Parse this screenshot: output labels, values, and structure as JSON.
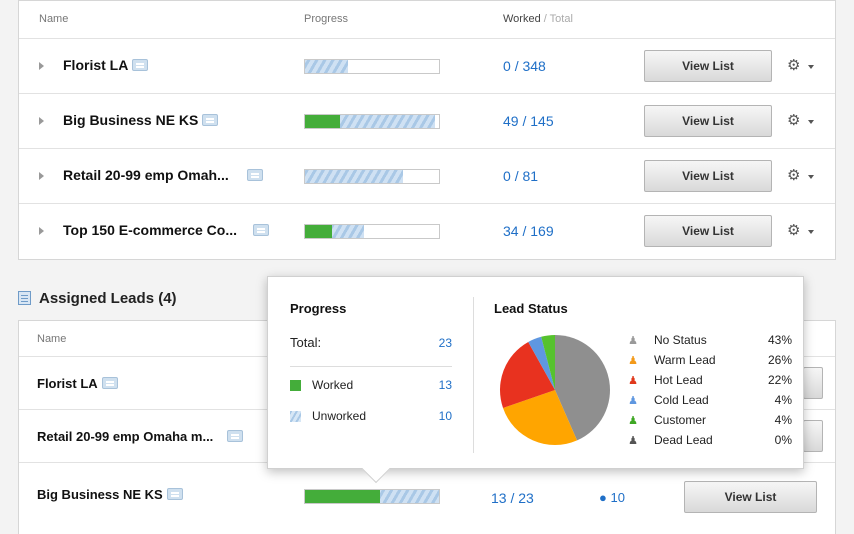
{
  "lists_table": {
    "headers": {
      "name": "Name",
      "progress": "Progress",
      "worked": "Worked",
      "total": "/ Total"
    },
    "rows": [
      {
        "name": "Florist LA",
        "worked": "0",
        "total": "/ 348",
        "progress_worked": 0,
        "progress_unworked": 0.32,
        "button": "View List"
      },
      {
        "name": "Big Business NE KS",
        "worked": "49",
        "total": "/ 145",
        "progress_worked": 0.26,
        "progress_unworked": 0.97,
        "button": "View List"
      },
      {
        "name": "Retail 20-99 emp Omah...",
        "worked": "0",
        "total": "/ 81",
        "progress_worked": 0,
        "progress_unworked": 0.73,
        "button": "View List"
      },
      {
        "name": "Top 150 E-commerce Co...",
        "worked": "34",
        "total": "/ 169",
        "progress_worked": 0.2,
        "progress_unworked": 0.44,
        "button": "View List"
      }
    ]
  },
  "assigned": {
    "title": "Assigned Leads (4)",
    "headers": {
      "name": "Name"
    },
    "rows": [
      {
        "name": "Florist LA"
      },
      {
        "name": "Retail 20-99 emp Omaha m..."
      },
      {
        "name": "Big Business NE KS",
        "worked": "13",
        "total": "/ 23",
        "unworked_count": "10",
        "progress_worked": 0.56,
        "progress_unworked": 1.0,
        "button": "View List"
      }
    ]
  },
  "popover": {
    "progress_title": "Progress",
    "total_label": "Total:",
    "total_value": "23",
    "worked_label": "Worked",
    "worked_value": "13",
    "unworked_label": "Unworked",
    "unworked_value": "10",
    "status_title": "Lead Status",
    "statuses": [
      {
        "label": "No Status",
        "pct": "43%",
        "value": 43,
        "color": "#8f8f8f",
        "icon_color": "#9a9a9a"
      },
      {
        "label": "Warm Lead",
        "pct": "26%",
        "value": 26,
        "color": "#ffa500",
        "icon_color": "#f39a1a"
      },
      {
        "label": "Hot Lead",
        "pct": "22%",
        "value": 22,
        "color": "#e8321f",
        "icon_color": "#e0391c"
      },
      {
        "label": "Cold Lead",
        "pct": "4%",
        "value": 4,
        "color": "#5f97e0",
        "icon_color": "#5f97e0"
      },
      {
        "label": "Customer",
        "pct": "4%",
        "value": 4,
        "color": "#56c22e",
        "icon_color": "#3ea724"
      },
      {
        "label": "Dead Lead",
        "pct": "0%",
        "value": 0,
        "color": "#555555",
        "icon_color": "#555555"
      }
    ]
  },
  "colors": {
    "accent": "#1f6fc7",
    "worked": "#44ad3a",
    "unworked": "#a9c8e6"
  }
}
